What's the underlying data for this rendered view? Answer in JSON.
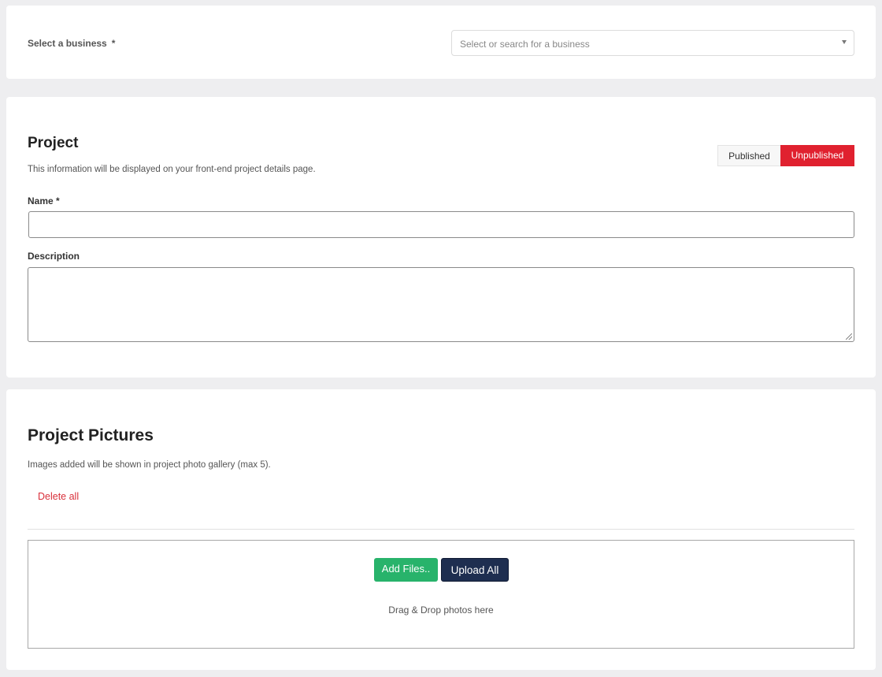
{
  "business": {
    "label": "Select a business",
    "required_mark": "*",
    "select_placeholder": "Select or search for a business"
  },
  "project": {
    "title": "Project",
    "description": "This information will be displayed on your front-end project details page.",
    "status_toggle": {
      "published_label": "Published",
      "unpublished_label": "Unpublished",
      "selected": "Unpublished",
      "selected_color": "#e0212f"
    },
    "fields": {
      "name_label": "Name *",
      "name_value": "",
      "description_label": "Description",
      "description_value": ""
    }
  },
  "pictures": {
    "title": "Project Pictures",
    "description": "Images added will be shown in project photo gallery (max 5).",
    "delete_all_label": "Delete all",
    "add_files_label": "Add Files..",
    "upload_all_label": "Upload All",
    "drop_hint": "Drag & Drop photos here",
    "colors": {
      "add_button": "#28b36b",
      "upload_button": "#1e2e50",
      "delete_link": "#d9303b"
    }
  }
}
